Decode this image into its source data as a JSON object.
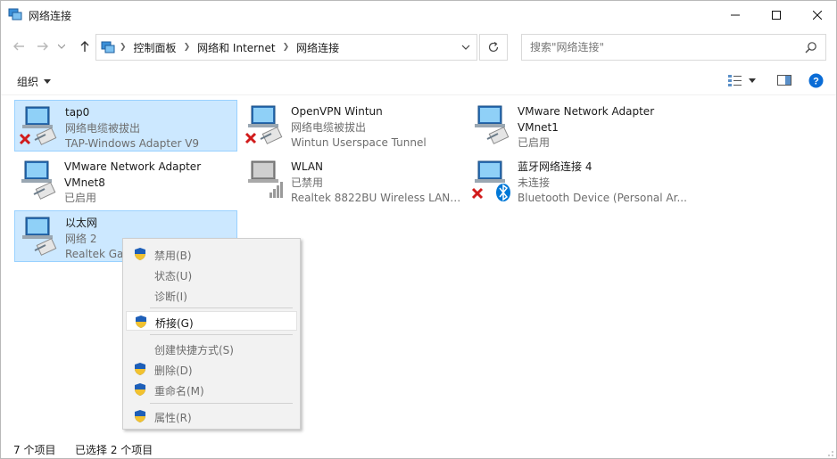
{
  "window": {
    "title": "网络连接"
  },
  "address": {
    "crumbs": [
      "控制面板",
      "网络和 Internet",
      "网络连接"
    ]
  },
  "search": {
    "placeholder": "搜索\"网络连接\""
  },
  "toolbar": {
    "organize_label": "组织"
  },
  "items": [
    {
      "name": "tap0",
      "line2": "网络电缆被拔出",
      "line3": "TAP-Windows Adapter V9",
      "status": "disconnected",
      "selected": true
    },
    {
      "name": "OpenVPN Wintun",
      "line2": "网络电缆被拔出",
      "line3": "Wintun Userspace Tunnel",
      "status": "disconnected",
      "selected": false
    },
    {
      "name": "VMware Network Adapter",
      "line2": "VMnet1",
      "line3": "已启用",
      "status": "enabled",
      "selected": false
    },
    {
      "name": "VMware Network Adapter",
      "line2": "VMnet8",
      "line3": "已启用",
      "status": "enabled",
      "selected": false
    },
    {
      "name": "WLAN",
      "line2": "已禁用",
      "line3": "Realtek 8822BU Wireless LAN ...",
      "status": "disabled-wireless",
      "selected": false
    },
    {
      "name": "蓝牙网络连接 4",
      "line2": "未连接",
      "line3": "Bluetooth Device (Personal Ar...",
      "status": "bluetooth-disconnected",
      "selected": false
    },
    {
      "name": "以太网",
      "line2": "网络 2",
      "line3": "Realtek Ga",
      "status": "enabled",
      "selected": true
    }
  ],
  "context_menu": {
    "disable": "禁用(B)",
    "status": "状态(U)",
    "diagnose": "诊断(I)",
    "bridge": "桥接(G)",
    "shortcut": "创建快捷方式(S)",
    "delete": "删除(D)",
    "rename": "重命名(M)",
    "properties": "属性(R)"
  },
  "statusbar": {
    "count": "7 个项目",
    "selected": "已选择 2 个项目"
  },
  "colors": {
    "selection_bg": "#cce8ff",
    "selection_border": "#99d1ff",
    "help_blue": "#0a6cd6",
    "error_red": "#d11b1b",
    "bluetooth_blue": "#0078d7"
  }
}
